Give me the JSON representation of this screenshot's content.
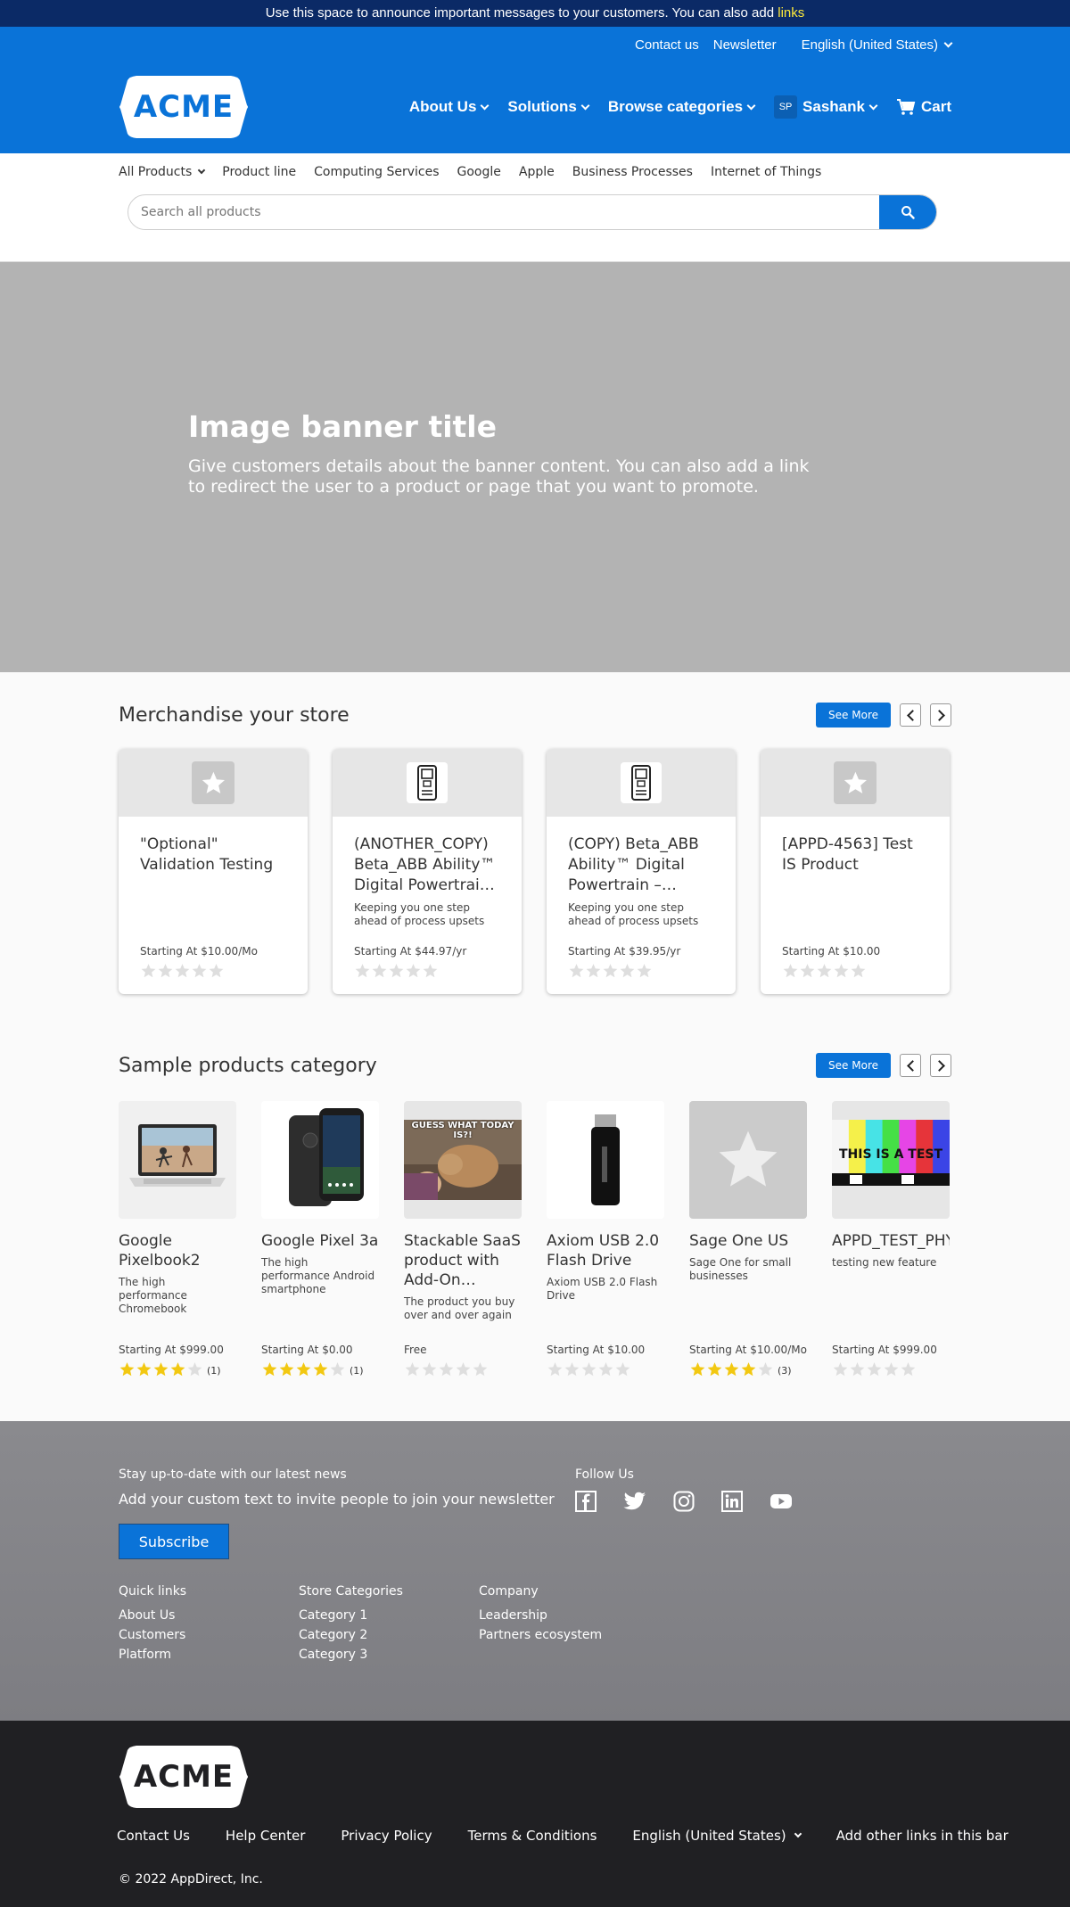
{
  "announcement": {
    "text": "Use this space to announce important messages to your customers. You can also add",
    "link": "links"
  },
  "header": {
    "utility": {
      "contact": "Contact us",
      "newsletter": "Newsletter",
      "language": "English (United States)"
    },
    "logo": "ACME",
    "nav": {
      "about": "About Us",
      "solutions": "Solutions",
      "browse": "Browse categories",
      "user_initials": "SP",
      "user_name": "Sashank",
      "cart": "Cart"
    }
  },
  "categories": [
    "All Products",
    "Product line",
    "Computing Services",
    "Google",
    "Apple",
    "Business Processes",
    "Internet of Things"
  ],
  "search": {
    "placeholder": "Search all products"
  },
  "banner": {
    "title": "Image banner title",
    "description": "Give customers details about the banner content. You can also add a link to redirect the user to a product or page that you want to promote."
  },
  "merch": {
    "title": "Merchandise your store",
    "see_more": "See More",
    "items": [
      {
        "name": "\"Optional\" Validation Testing",
        "desc": "",
        "price": "Starting At $10.00/Mo",
        "icon": "star-placeholder-icon"
      },
      {
        "name": "(ANOTHER_COPY) Beta_ABB Ability™ Digital Powertrai…",
        "desc": "Keeping you one step ahead of process upsets",
        "price": "Starting At $44.97/yr",
        "icon": "device-icon"
      },
      {
        "name": "(COPY) Beta_ABB Ability™ Digital Powertrain –…",
        "desc": "Keeping you one step ahead of process upsets",
        "price": "Starting At $39.95/yr",
        "icon": "device-icon"
      },
      {
        "name": "[APPD-4563] Test IS Product",
        "desc": "",
        "price": "Starting At $10.00",
        "icon": "star-placeholder-icon"
      }
    ]
  },
  "sample": {
    "title": "Sample products category",
    "see_more": "See More",
    "items": [
      {
        "name": "Google Pixelbook2",
        "desc": "The high performance Chromebook",
        "price": "Starting At $999.00",
        "rating": 4,
        "count": "(1)",
        "image": "laptop-image"
      },
      {
        "name": "Google Pixel 3a",
        "desc": "The high performance Android smartphone",
        "price": "Starting At $0.00",
        "rating": 4,
        "count": "(1)",
        "image": "phone-image"
      },
      {
        "name": "Stackable SaaS product with Add-On…",
        "desc": "The product you buy over and over again",
        "price": "Free",
        "rating": 0,
        "count": "",
        "image": "camel-meme-image",
        "meme_text": "GUESS WHAT TODAY IS?!"
      },
      {
        "name": "Axiom USB 2.0 Flash Drive",
        "desc": "Axiom USB 2.0 Flash Drive",
        "price": "Starting At $10.00",
        "rating": 0,
        "count": "",
        "image": "usb-drive-image"
      },
      {
        "name": "Sage One US",
        "desc": "Sage One for small businesses",
        "price": "Starting At $10.00/Mo",
        "rating": 4,
        "count": "(3)",
        "image": "star-placeholder-image"
      },
      {
        "name": "APPD_TEST_PHYSICAL",
        "desc": "testing new feature",
        "price": "Starting At $999.00",
        "rating": 0,
        "count": "",
        "image": "test-pattern-image",
        "pattern_text": "THIS IS A TEST"
      }
    ]
  },
  "footer": {
    "news_label": "Stay up-to-date with our latest news",
    "news_text": "Add your custom text to invite people to join your newsletter",
    "subscribe": "Subscribe",
    "follow": "Follow Us",
    "social": [
      "facebook-icon",
      "twitter-icon",
      "instagram-icon",
      "linkedin-icon",
      "youtube-icon"
    ],
    "columns": [
      {
        "title": "Quick links",
        "links": [
          "About Us",
          "Customers",
          "Platform"
        ]
      },
      {
        "title": "Store Categories",
        "links": [
          "Category 1",
          "Category 2",
          "Category 3"
        ]
      },
      {
        "title": "Company",
        "links": [
          "Leadership",
          "Partners ecosystem"
        ]
      }
    ]
  },
  "bottom": {
    "logo": "ACME",
    "links": [
      "Contact Us",
      "Help Center",
      "Privacy Policy",
      "Terms & Conditions",
      "English (United States)",
      "Add other links in this bar"
    ],
    "copyright": "© 2022 AppDirect, Inc."
  },
  "colors": {
    "brand": "#0a73d8",
    "announce_bg": "#0b2a66",
    "star": "#f2c811",
    "footer_bg": "#85858a",
    "bottom_bg": "#202023"
  }
}
